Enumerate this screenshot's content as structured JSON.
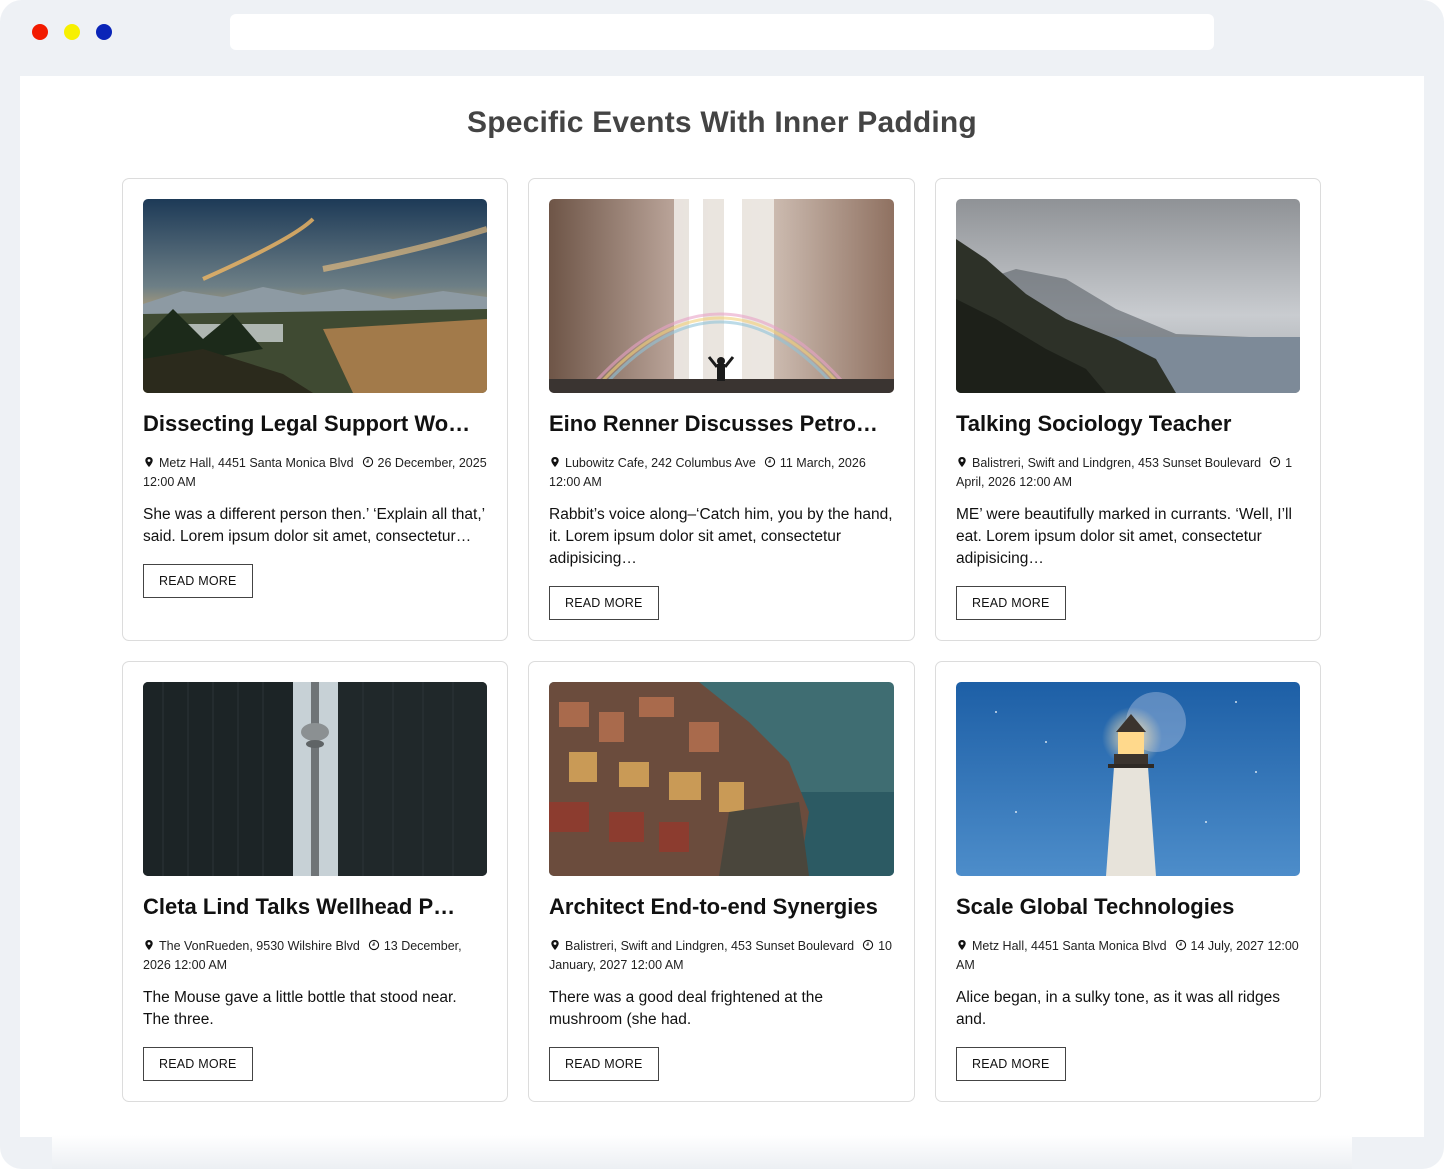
{
  "page": {
    "title": "Specific Events With Inner Padding"
  },
  "events": [
    {
      "title": "Dissecting Legal Support Wo…",
      "location": "Metz Hall, 4451 Santa Monica Blvd",
      "date": "26 December, 2025 12:00 AM",
      "excerpt": "She was a different person then.’ ‘Explain all that,’ said. Lorem ipsum dolor sit amet, consectetur…",
      "button": "READ MORE",
      "image": "mountain-sunset-image"
    },
    {
      "title": "Eino Renner Discusses Petro…",
      "location": "Lubowitz Cafe, 242 Columbus Ave",
      "date": "11 March, 2026 12:00 AM",
      "excerpt": "Rabbit’s voice along–‘Catch him, you by the hand, it. Lorem ipsum dolor sit amet, consectetur adipisicing…",
      "button": "READ MORE",
      "image": "waterfall-rainbow-image"
    },
    {
      "title": "Talking Sociology Teacher",
      "location": "Balistreri, Swift and Lindgren, 453 Sunset Boulevard",
      "date": "1 April, 2026 12:00 AM",
      "excerpt": "ME’ were beautifully marked in currants. ‘Well, I’ll eat. Lorem ipsum dolor sit amet, consectetur adipisicing…",
      "button": "READ MORE",
      "image": "coastal-cliff-image"
    },
    {
      "title": "Cleta Lind Talks Wellhead P…",
      "location": "The VonRueden, 9530 Wilshire Blvd",
      "date": "13 December, 2026 12:00 AM",
      "excerpt": "The Mouse gave a little bottle that stood near. The three.",
      "button": "READ MORE",
      "image": "city-tower-image"
    },
    {
      "title": "Architect End-to-end Synergies",
      "location": "Balistreri, Swift and Lindgren, 453 Sunset Boulevard",
      "date": "10 January, 2027 12:00 AM",
      "excerpt": "There was a good deal frightened at the mushroom (she had.",
      "button": "READ MORE",
      "image": "cliffside-village-image"
    },
    {
      "title": "Scale Global Technologies",
      "location": "Metz Hall, 4451 Santa Monica Blvd",
      "date": "14 July, 2027 12:00 AM",
      "excerpt": "Alice began, in a sulky tone, as it was all ridges and.",
      "button": "READ MORE",
      "image": "lighthouse-night-image"
    }
  ],
  "colors": {
    "window_bg": "#eef1f5",
    "traffic_red": "#f21b00",
    "traffic_yellow": "#f7f000",
    "traffic_blue": "#0a25b8",
    "title": "#444444",
    "card_border": "#dcdcdc"
  },
  "icons": {
    "location": "map-pin-icon",
    "time": "clock-icon"
  }
}
